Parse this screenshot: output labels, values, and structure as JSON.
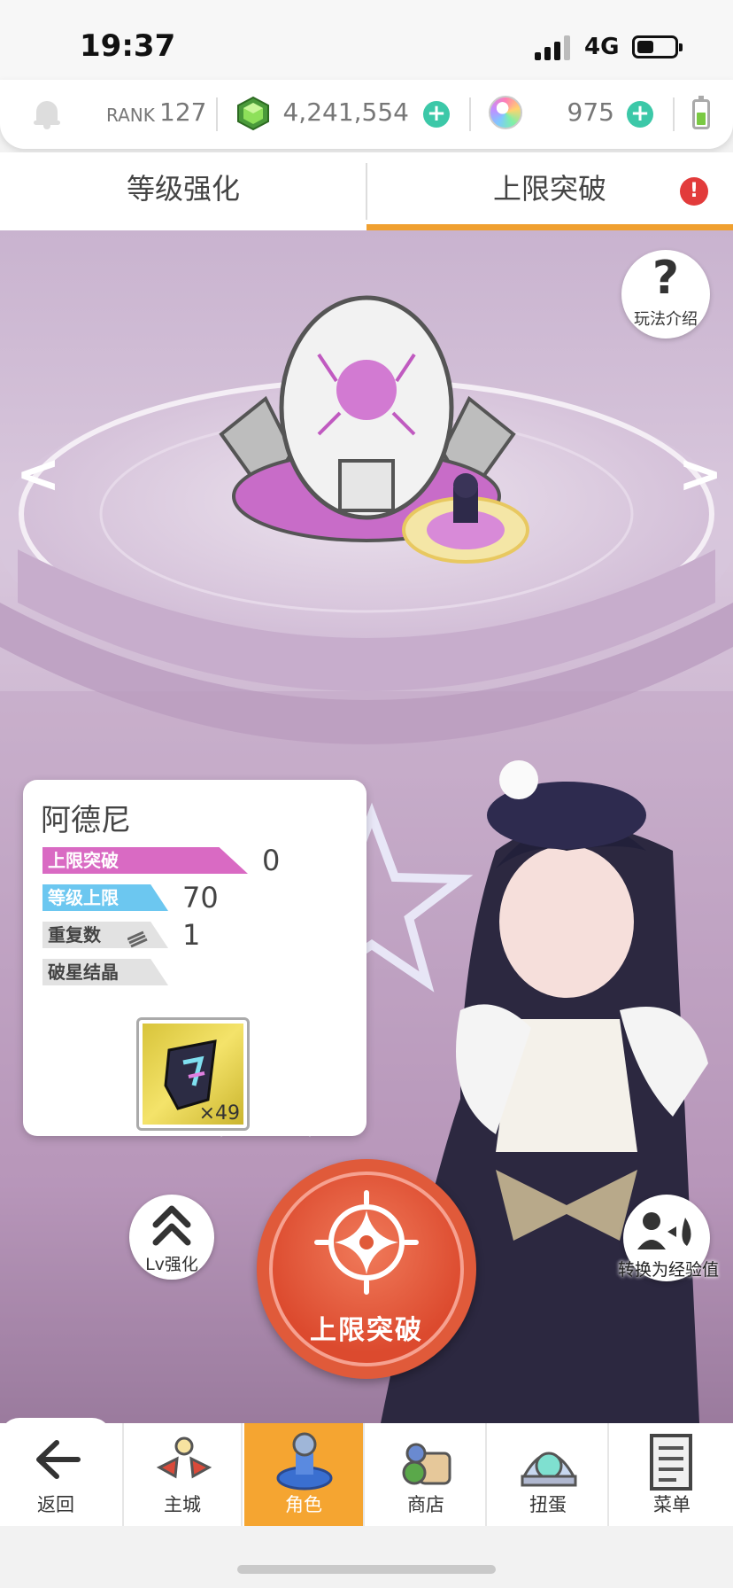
{
  "status": {
    "time": "19:37",
    "network": "4G"
  },
  "currency": {
    "rank_label": "RANK",
    "rank_value": "127",
    "gems": "4,241,554",
    "orbs": "975"
  },
  "tabs": [
    {
      "label": "等级强化"
    },
    {
      "label": "上限突破",
      "alert": "!"
    }
  ],
  "help": {
    "icon": "?",
    "label": "玩法介绍"
  },
  "nav_arrows": {
    "prev": "<",
    "next": ">"
  },
  "character": {
    "name": "阿德尼",
    "rows": [
      {
        "label": "上限突破",
        "value": "0"
      },
      {
        "label": "等级上限",
        "value": "70"
      },
      {
        "label": "重复数",
        "value": "1"
      },
      {
        "label": "破星结晶",
        "value": ""
      }
    ],
    "item": {
      "name": "crystal-shard-icon",
      "count": "×49"
    }
  },
  "actions": {
    "break_label": "上限突破",
    "lv_label": "Lv强化",
    "exp_label": "转换为经验值"
  },
  "bottom_nav": [
    {
      "label": "返回",
      "icon": "back-arrow-icon"
    },
    {
      "label": "主城",
      "icon": "city-icon"
    },
    {
      "label": "角色",
      "icon": "character-icon",
      "active": true
    },
    {
      "label": "商店",
      "icon": "shop-icon"
    },
    {
      "label": "扭蛋",
      "icon": "gacha-icon"
    },
    {
      "label": "菜单",
      "icon": "menu-icon"
    }
  ],
  "colors": {
    "accent_orange": "#f5a531",
    "break_red": "#e05a3a",
    "tag_pink": "#d96ac3",
    "tag_blue": "#6cc7f0",
    "plus_teal": "#3cc8a8"
  }
}
